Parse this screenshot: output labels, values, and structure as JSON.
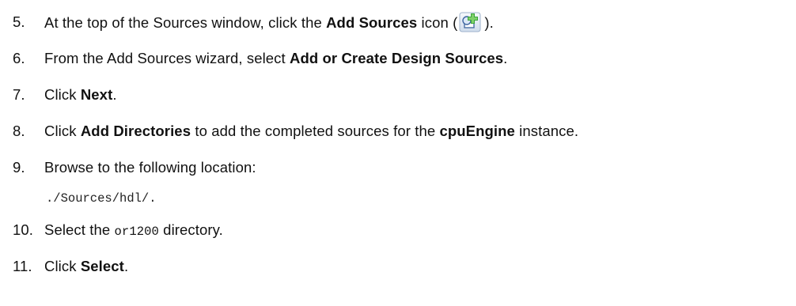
{
  "steps": [
    {
      "num": "5.",
      "parts": [
        {
          "t": "At the top of the Sources window, click the "
        },
        {
          "t": "Add Sources",
          "b": true
        },
        {
          "t": " icon ("
        },
        {
          "icon": "add-sources-icon"
        },
        {
          "t": ")."
        }
      ]
    },
    {
      "num": "6.",
      "parts": [
        {
          "t": "From the Add Sources wizard, select "
        },
        {
          "t": "Add or Create Design Sources",
          "b": true
        },
        {
          "t": "."
        }
      ]
    },
    {
      "num": "7.",
      "parts": [
        {
          "t": "Click "
        },
        {
          "t": "Next",
          "b": true
        },
        {
          "t": "."
        }
      ]
    },
    {
      "num": "8.",
      "parts": [
        {
          "t": "Click "
        },
        {
          "t": "Add Directories",
          "b": true
        },
        {
          "t": " to add the completed sources for the "
        },
        {
          "t": "cpuEngine",
          "b": true
        },
        {
          "t": " instance."
        }
      ]
    },
    {
      "num": "9.",
      "parts": [
        {
          "t": "Browse to the following location:"
        }
      ]
    },
    {
      "num": "10.",
      "parts": [
        {
          "t": "Select the "
        },
        {
          "t": "or1200",
          "mono": true
        },
        {
          "t": " directory."
        }
      ]
    },
    {
      "num": "11.",
      "parts": [
        {
          "t": "Click "
        },
        {
          "t": "Select",
          "b": true
        },
        {
          "t": "."
        }
      ]
    }
  ],
  "path": "./Sources/hdl/."
}
